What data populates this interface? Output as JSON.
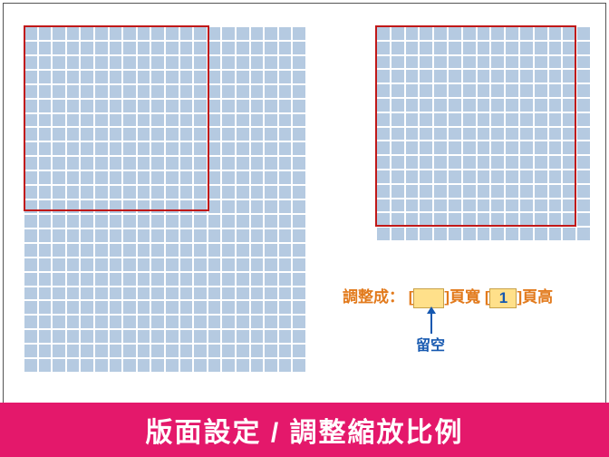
{
  "banner": "版面設定 / 調整縮放比例",
  "annot": {
    "label_adjust": "調整成：",
    "bracket_open1": "[",
    "bracket_close1": "]",
    "pages_wide": "頁寬",
    "bracket_open2": "[",
    "value_tall": "1",
    "bracket_close2": "]",
    "pages_tall": "頁高",
    "leave_blank": "留空"
  }
}
